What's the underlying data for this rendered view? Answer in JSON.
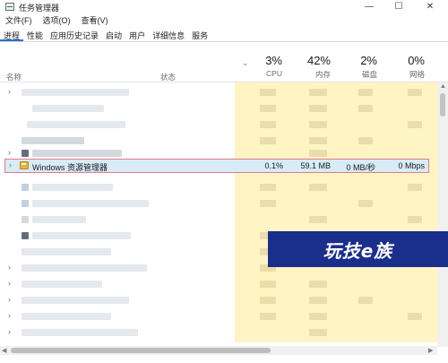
{
  "window": {
    "title": "任务管理器",
    "controls": {
      "minimize": "—",
      "maximize": "☐",
      "close": "✕"
    }
  },
  "menu": [
    {
      "label": "文件(F)"
    },
    {
      "label": "选项(O)"
    },
    {
      "label": "查看(V)"
    }
  ],
  "tabs": [
    {
      "label": "进程",
      "active": true
    },
    {
      "label": "性能"
    },
    {
      "label": "应用历史记录"
    },
    {
      "label": "启动"
    },
    {
      "label": "用户"
    },
    {
      "label": "详细信息"
    },
    {
      "label": "服务"
    }
  ],
  "header": {
    "name": "名称",
    "status": "状态",
    "sort_indicator": "⌄",
    "cpu": {
      "pct": "3%",
      "label": "CPU"
    },
    "memory": {
      "pct": "42%",
      "label": "内存"
    },
    "disk": {
      "pct": "2%",
      "label": "磁盘"
    },
    "network": {
      "pct": "0%",
      "label": "网络"
    }
  },
  "highlighted_row": {
    "name": "Windows 资源管理器",
    "cpu": "0.1%",
    "memory": "59.1 MB",
    "disk": "0 MB/秒",
    "network": "0 Mbps"
  },
  "banner": {
    "text": "玩技e族"
  },
  "colors": {
    "yellow_band": "#fff4c4",
    "highlight_row": "#d9ebf7",
    "highlight_border": "#e27a8c",
    "banner": "#1a2e8c",
    "tab_accent": "#2b6dd1"
  }
}
